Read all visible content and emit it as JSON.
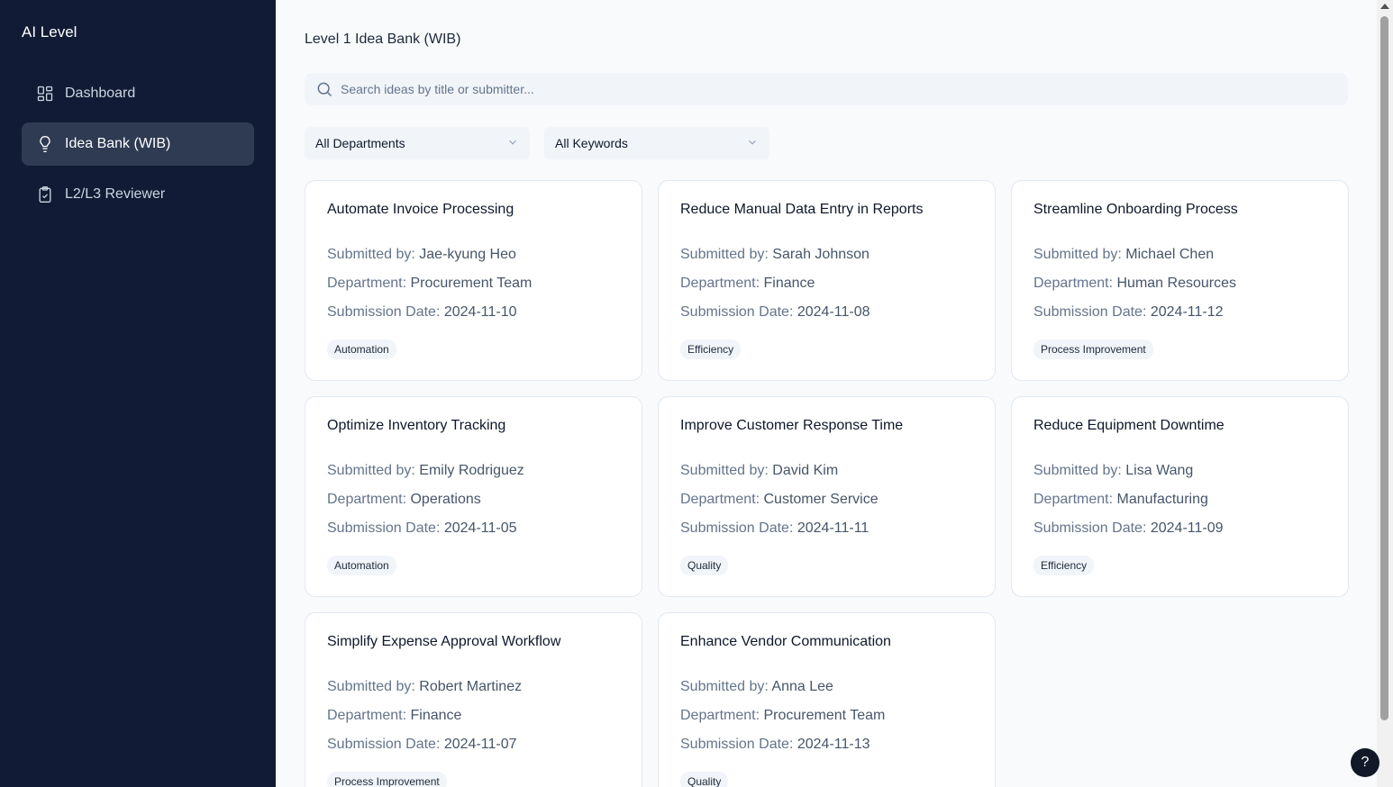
{
  "app": {
    "title": "AI Level"
  },
  "sidebar": {
    "items": [
      {
        "label": "Dashboard",
        "icon": "grid-icon"
      },
      {
        "label": "Idea Bank (WIB)",
        "icon": "lightbulb-icon",
        "active": true
      },
      {
        "label": "L2/L3 Reviewer",
        "icon": "clipboard-check-icon"
      }
    ]
  },
  "main": {
    "title": "Level 1 Idea Bank (WIB)",
    "search": {
      "placeholder": "Search ideas by title or submitter...",
      "value": ""
    },
    "filters": {
      "department": "All Departments",
      "keywords": "All Keywords"
    },
    "labels": {
      "submitted_by": "Submitted by: ",
      "department": "Department: ",
      "submission_date": "Submission Date: "
    },
    "cards": [
      {
        "title": "Automate Invoice Processing",
        "submitter": "Jae-kyung Heo",
        "department": "Procurement Team",
        "date": "2024-11-10",
        "tag": "Automation"
      },
      {
        "title": "Reduce Manual Data Entry in Reports",
        "submitter": "Sarah Johnson",
        "department": "Finance",
        "date": "2024-11-08",
        "tag": "Efficiency"
      },
      {
        "title": "Streamline Onboarding Process",
        "submitter": "Michael Chen",
        "department": "Human Resources",
        "date": "2024-11-12",
        "tag": "Process Improvement"
      },
      {
        "title": "Optimize Inventory Tracking",
        "submitter": "Emily Rodriguez",
        "department": "Operations",
        "date": "2024-11-05",
        "tag": "Automation"
      },
      {
        "title": "Improve Customer Response Time",
        "submitter": "David Kim",
        "department": "Customer Service",
        "date": "2024-11-11",
        "tag": "Quality"
      },
      {
        "title": "Reduce Equipment Downtime",
        "submitter": "Lisa Wang",
        "department": "Manufacturing",
        "date": "2024-11-09",
        "tag": "Efficiency"
      },
      {
        "title": "Simplify Expense Approval Workflow",
        "submitter": "Robert Martinez",
        "department": "Finance",
        "date": "2024-11-07",
        "tag": "Process Improvement"
      },
      {
        "title": "Enhance Vendor Communication",
        "submitter": "Anna Lee",
        "department": "Procurement Team",
        "date": "2024-11-13",
        "tag": "Quality"
      }
    ]
  },
  "help": {
    "label": "?"
  }
}
